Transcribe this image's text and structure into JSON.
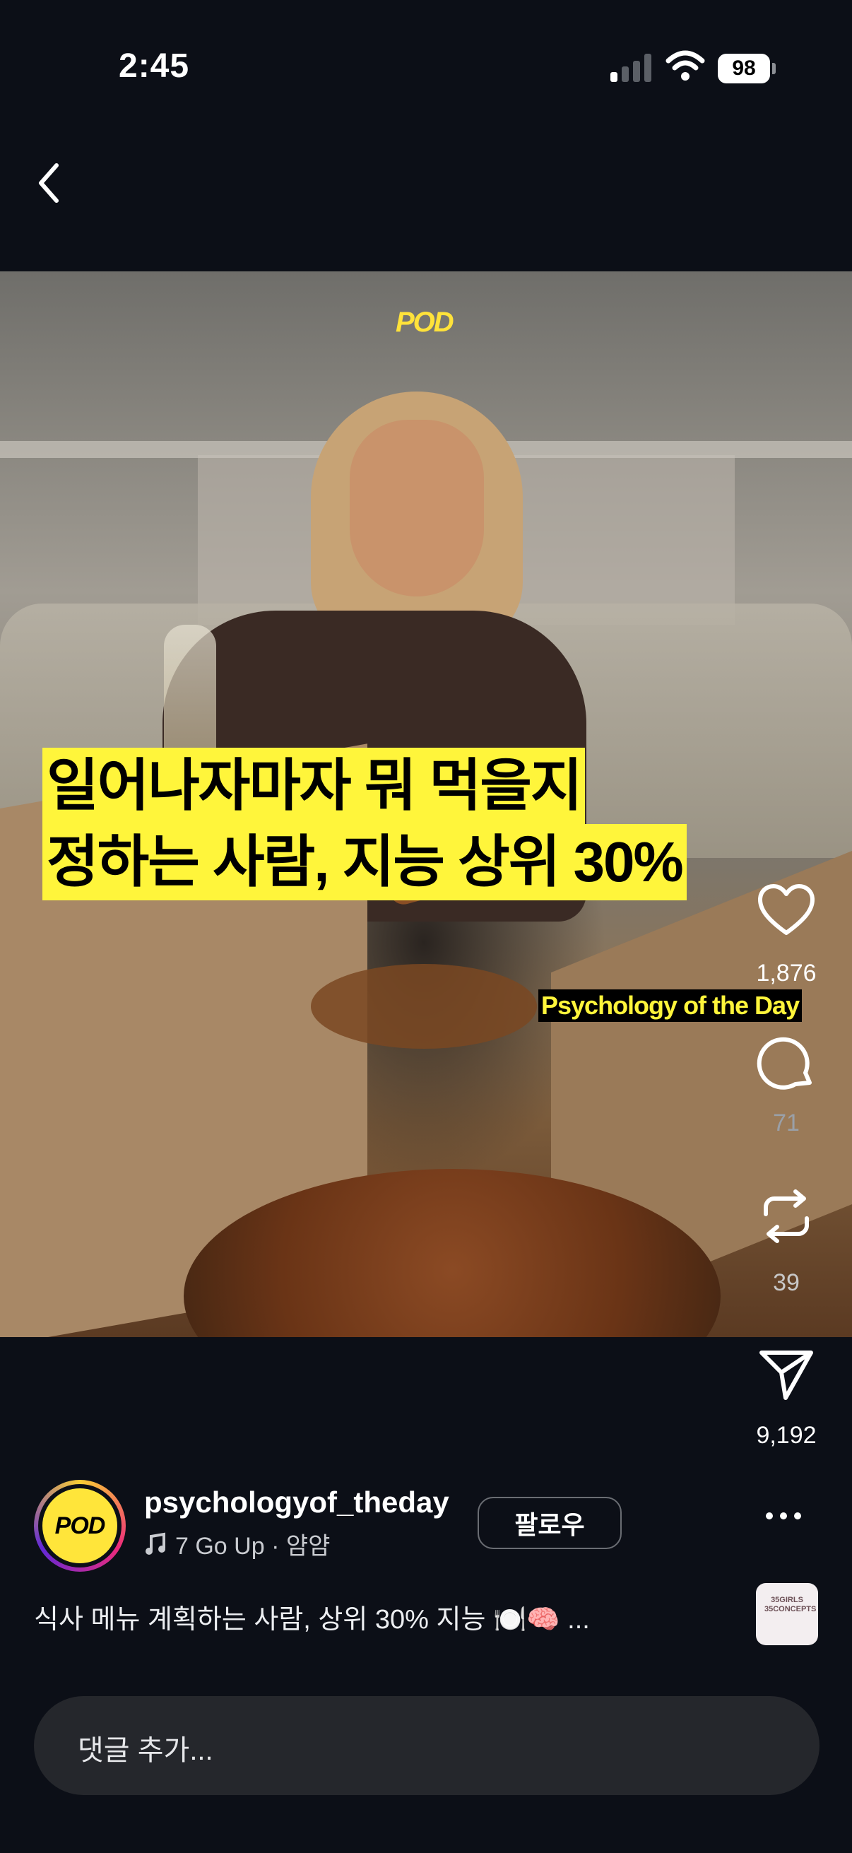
{
  "status_bar": {
    "time": "2:45",
    "battery": "98"
  },
  "media": {
    "logo_text": "POD",
    "headline_line1": "일어나자마자 뭐 먹을지",
    "headline_line2": "정하는 사람, 지능 상위 30%",
    "brand_tag": "Psychology of the Day"
  },
  "rail": {
    "like_count": "1,876",
    "comment_count": "71",
    "repost_count": "39",
    "share_count": "9,192"
  },
  "author": {
    "avatar_text": "POD",
    "username": "psychologyof_theday",
    "music": "7 Go Up · 얌얌",
    "follow_label": "팔로우"
  },
  "caption": "식사 메뉴 계획하는 사람, 상위 30% 지능 🍽️🧠 ...",
  "thumb_text": "35GIRLS 35CONCEPTS",
  "comment": {
    "placeholder": "댓글 추가..."
  },
  "colors": {
    "background": "#0c0f17",
    "headline_bg": "#fff53b",
    "avatar_bg": "#ffe53a"
  }
}
